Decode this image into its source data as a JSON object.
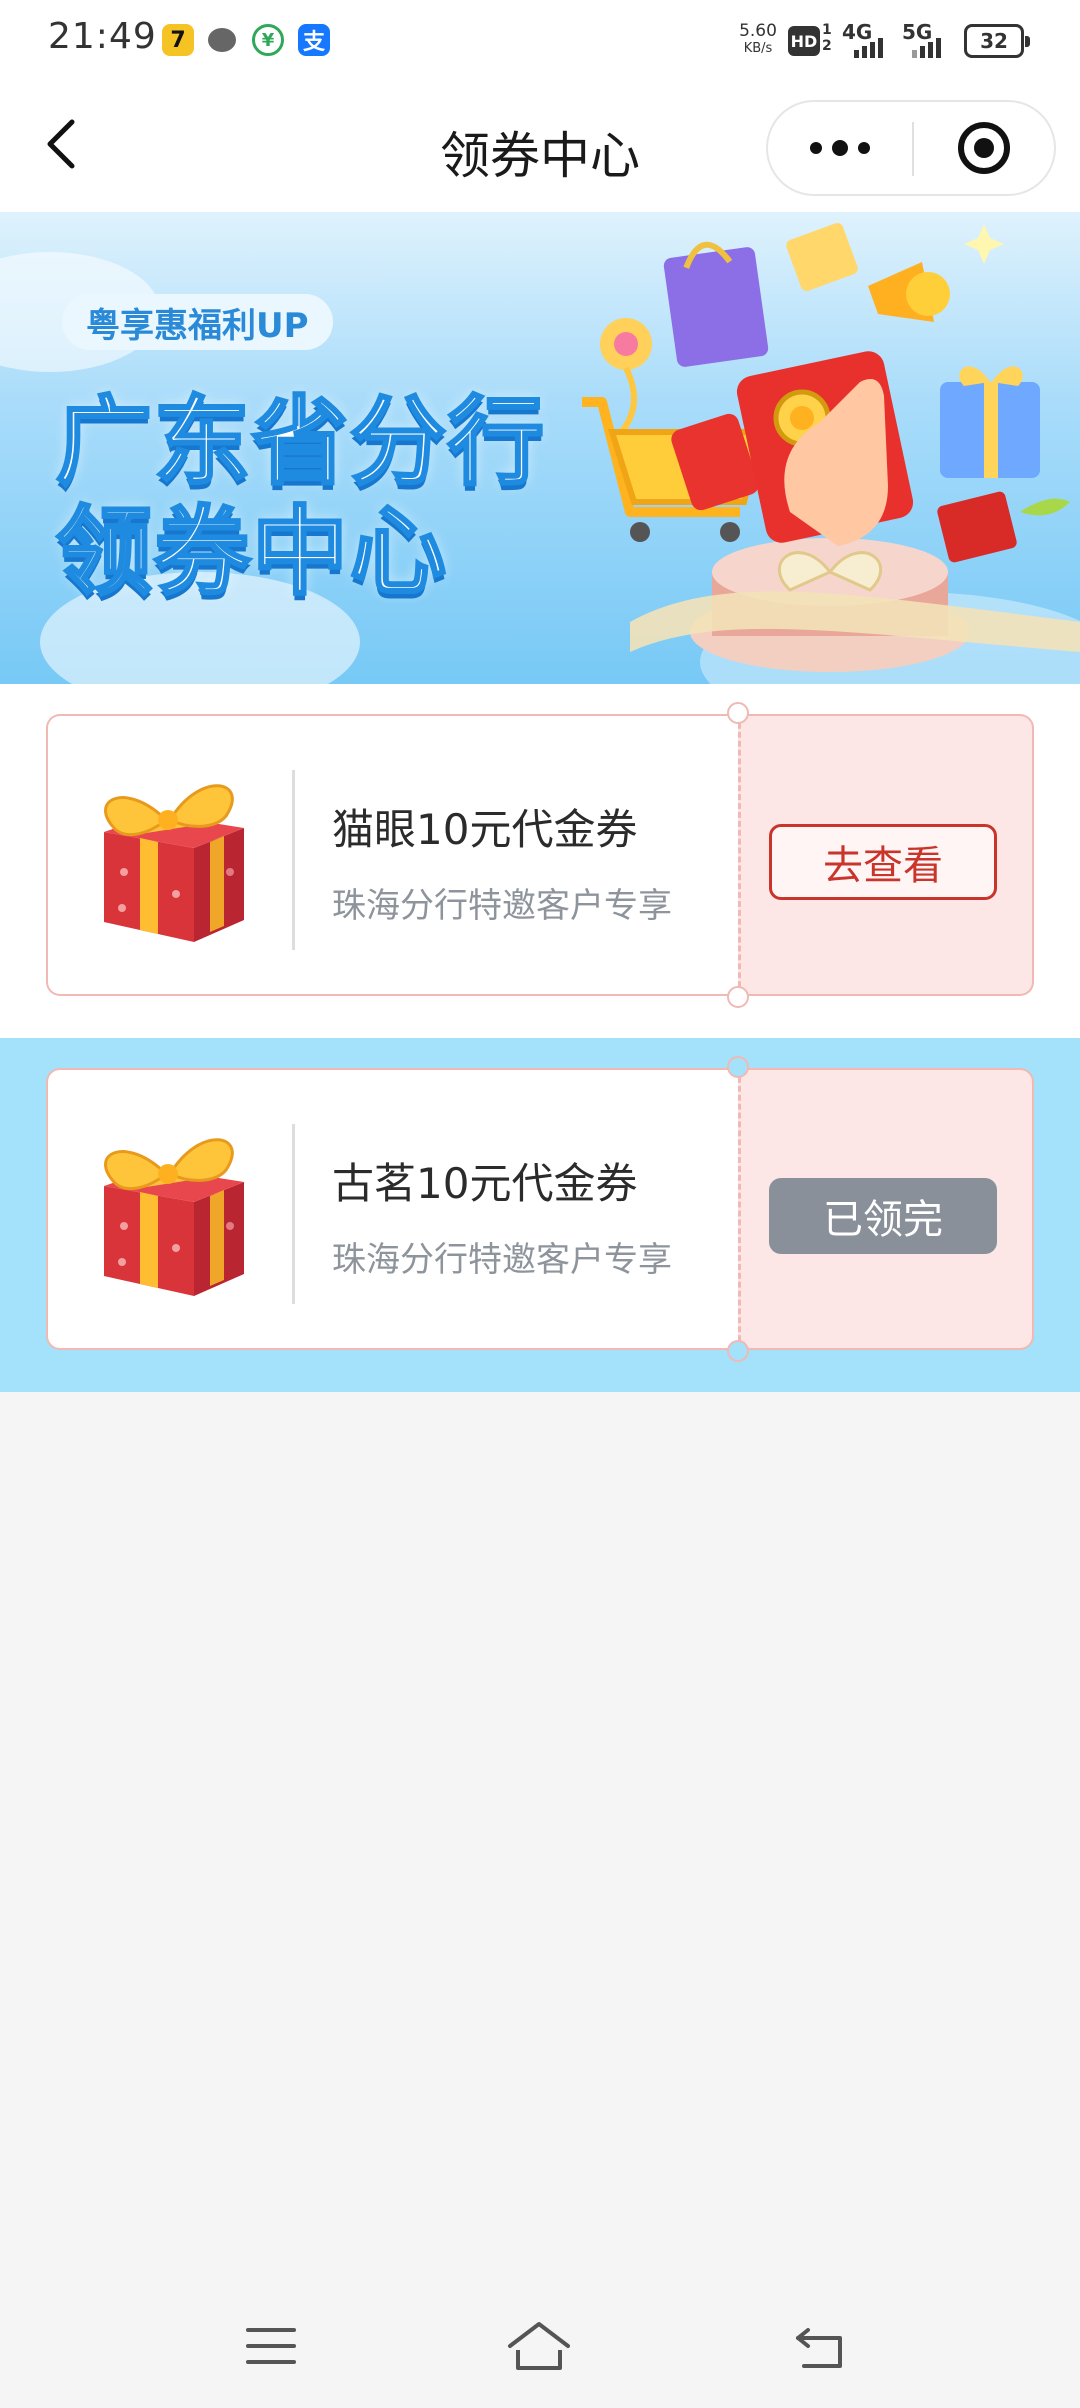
{
  "status_bar": {
    "time": "21:49",
    "net_speed_value": "5.60",
    "net_speed_unit": "KB/s",
    "hd": "HD",
    "sim_1": "1",
    "sim_2": "2",
    "signal_1": "4G",
    "signal_2": "5G",
    "battery": "32",
    "app_icons": [
      "qq-icon",
      "chat-icon",
      "payment-icon",
      "alipay-icon"
    ],
    "alipay_glyph": "支"
  },
  "nav": {
    "title": "领券中心",
    "back_icon": "chevron-left-icon",
    "more_icon": "more-icon",
    "close_icon": "target-icon"
  },
  "banner": {
    "tag": "粤享惠福利UP",
    "title_line1": "广东省分行",
    "title_line2": "领券中心",
    "bg_colors": [
      "#dff2fd",
      "#77c9f6"
    ]
  },
  "coupons": [
    {
      "name": "猫眼10元代金券",
      "desc": "珠海分行特邀客户专享",
      "action": "去查看",
      "state": "available",
      "icon": "gift-box-icon"
    },
    {
      "name": "古茗10元代金券",
      "desc": "珠海分行特邀客户专享",
      "action": "已领完",
      "state": "sold-out",
      "icon": "gift-box-icon"
    }
  ],
  "colors": {
    "accent_red": "#c9342b",
    "coupon_border": "#f0b9b4",
    "coupon_stub": "#fce6e6",
    "disabled_button": "#8a909a",
    "section_blue": "#a3e2fa"
  },
  "system_nav": [
    "menu-icon",
    "home-icon",
    "back-icon"
  ]
}
